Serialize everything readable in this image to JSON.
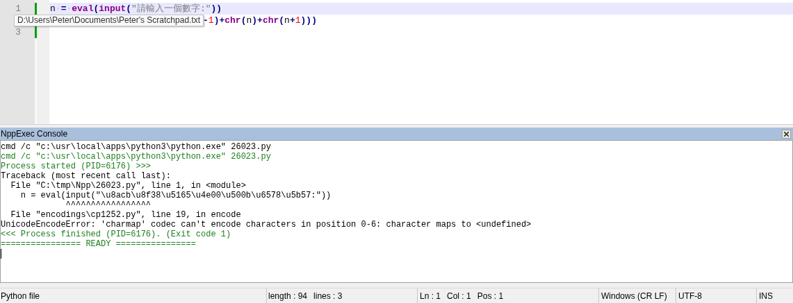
{
  "editor": {
    "lines": [
      {
        "number": "1",
        "current": true,
        "tokens": [
          {
            "kind": "id",
            "text": "n"
          },
          {
            "kind": "ws",
            "text": "·"
          },
          {
            "kind": "op",
            "text": "="
          },
          {
            "kind": "ws",
            "text": "·"
          },
          {
            "kind": "kw",
            "text": "eval"
          },
          {
            "kind": "op",
            "text": "("
          },
          {
            "kind": "kw",
            "text": "input"
          },
          {
            "kind": "op",
            "text": "("
          },
          {
            "kind": "str",
            "text": "\"請輸入一個數字:\""
          },
          {
            "kind": "op",
            "text": "))"
          }
        ]
      },
      {
        "current": false,
        "tokens": [
          {
            "kind": "op",
            "text": "-"
          },
          {
            "kind": "num",
            "text": "1"
          },
          {
            "kind": "op",
            "text": ")+"
          },
          {
            "kind": "kw",
            "text": "chr"
          },
          {
            "kind": "op",
            "text": "("
          },
          {
            "kind": "id",
            "text": "n"
          },
          {
            "kind": "op",
            "text": ")+"
          },
          {
            "kind": "kw",
            "text": "chr"
          },
          {
            "kind": "op",
            "text": "("
          },
          {
            "kind": "id",
            "text": "n"
          },
          {
            "kind": "op",
            "text": "+"
          },
          {
            "kind": "num",
            "text": "1"
          },
          {
            "kind": "op",
            "text": ")))"
          }
        ]
      },
      {
        "number": "3",
        "current": false
      }
    ],
    "tooltip": "D:\\Users\\Peter\\Documents\\Peter's Scratchpad.txt"
  },
  "console": {
    "title": "NppExec Console",
    "lines": [
      {
        "kind": "plain",
        "text": "cmd /c \"c:\\usr\\local\\apps\\python3\\python.exe\" 26023.py"
      },
      {
        "kind": "info",
        "text": "cmd /c \"c:\\usr\\local\\apps\\python3\\python.exe\" 26023.py"
      },
      {
        "kind": "info",
        "text": "Process started (PID=6176) >>>"
      },
      {
        "kind": "plain",
        "text": "Traceback (most recent call last):"
      },
      {
        "kind": "plain",
        "text": "  File \"C:\\tmp\\Npp\\26023.py\", line 1, in <module>"
      },
      {
        "kind": "plain",
        "text": "    n = eval(input(\"\\u8acb\\u8f38\\u5165\\u4e00\\u500b\\u6578\\u5b57:\"))"
      },
      {
        "kind": "plain",
        "text": "             ^^^^^^^^^^^^^^^^^"
      },
      {
        "kind": "plain",
        "text": "  File \"encodings\\cp1252.py\", line 19, in encode"
      },
      {
        "kind": "plain",
        "text": "UnicodeEncodeError: 'charmap' codec can't encode characters in position 0-6: character maps to <undefined>"
      },
      {
        "kind": "info",
        "text": "<<< Process finished (PID=6176). (Exit code 1)"
      },
      {
        "kind": "info",
        "text": "================ READY ================"
      }
    ]
  },
  "status_bar": {
    "file_type": "Python file",
    "length": "length : 94",
    "lines": "lines : 3",
    "ln": "Ln : 1",
    "col": "Col : 1",
    "pos": "Pos : 1",
    "eol": "Windows (CR LF)",
    "encoding": "UTF-8",
    "mode": "INS"
  }
}
